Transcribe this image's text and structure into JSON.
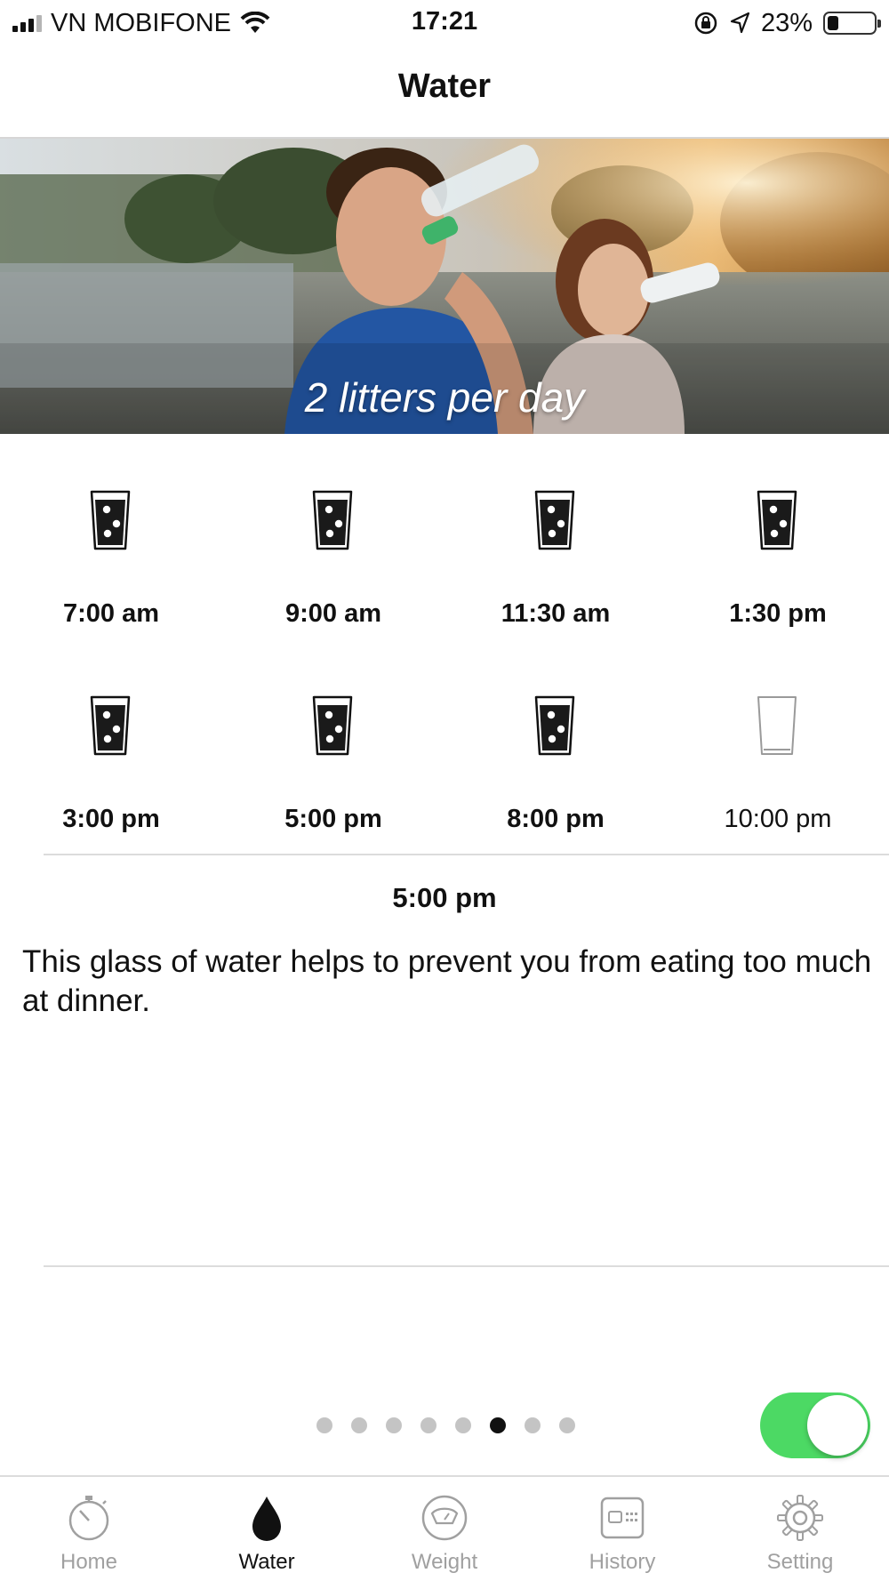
{
  "status_bar": {
    "carrier": "VN MOBIFONE",
    "time": "17:21",
    "battery_percent": "23%",
    "battery_level": 0.23
  },
  "header": {
    "title": "Water"
  },
  "hero": {
    "caption": "2 litters per day"
  },
  "schedule": [
    {
      "time": "7:00 am",
      "filled": true
    },
    {
      "time": "9:00 am",
      "filled": true
    },
    {
      "time": "11:30 am",
      "filled": true
    },
    {
      "time": "1:30 pm",
      "filled": true
    },
    {
      "time": "3:00 pm",
      "filled": true
    },
    {
      "time": "5:00 pm",
      "filled": true
    },
    {
      "time": "8:00 pm",
      "filled": true
    },
    {
      "time": "10:00 pm",
      "filled": false
    }
  ],
  "detail": {
    "time": "5:00 pm",
    "text": "This glass of water helps to prevent you from eating too much at dinner."
  },
  "pager": {
    "count": 8,
    "active_index": 5
  },
  "reminder_toggle": {
    "on": true,
    "color": "#4cd964"
  },
  "tabbar": {
    "active_index": 1,
    "items": [
      {
        "label": "Home",
        "icon": "stopwatch-icon"
      },
      {
        "label": "Water",
        "icon": "water-drop-icon"
      },
      {
        "label": "Weight",
        "icon": "scale-icon"
      },
      {
        "label": "History",
        "icon": "calendar-history-icon"
      },
      {
        "label": "Setting",
        "icon": "gear-icon"
      }
    ]
  }
}
